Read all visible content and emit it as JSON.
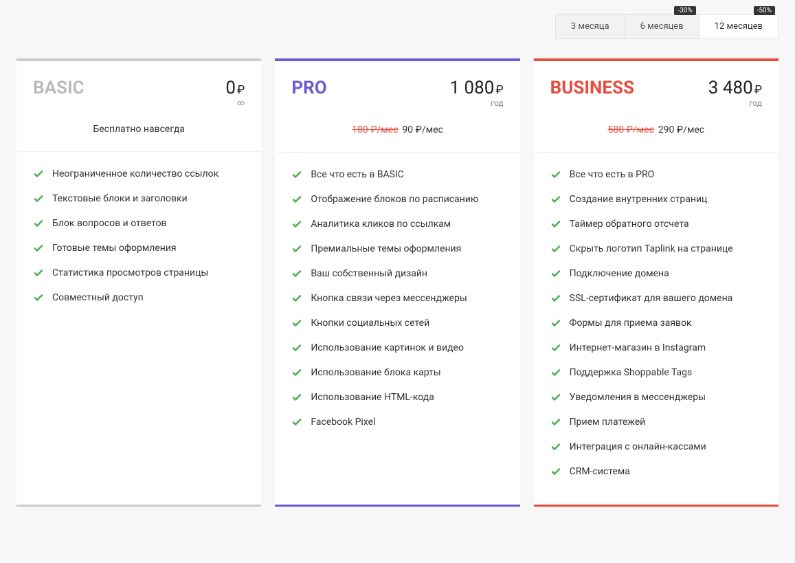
{
  "periodTabs": [
    {
      "label": "3 месяца",
      "badge": "",
      "active": false
    },
    {
      "label": "6 месяцев",
      "badge": "-30%",
      "active": false
    },
    {
      "label": "12 месяцев",
      "badge": "-50%",
      "active": true
    }
  ],
  "plans": [
    {
      "id": "basic",
      "name": "BASIC",
      "price": "0",
      "currency": "₽",
      "period": "∞",
      "subhead": {
        "strike": "",
        "text": "Бесплатно навсегда"
      },
      "features": [
        "Неограниченное количество ссылок",
        "Текстовые блоки и заголовки",
        "Блок вопросов и ответов",
        "Готовые темы оформления",
        "Статистика просмотров страницы",
        "Совместный доступ"
      ]
    },
    {
      "id": "pro",
      "name": "PRO",
      "price": "1 080",
      "currency": "₽",
      "period": "год",
      "subhead": {
        "strike": "180 ₽/мес",
        "text": "90 ₽/мес"
      },
      "features": [
        "Все что есть в BASIC",
        "Отображение блоков по расписанию",
        "Аналитика кликов по ссылкам",
        "Премиальные темы оформления",
        "Ваш собственный дизайн",
        "Кнопка связи через мессенджеры",
        "Кнопки социальных сетей",
        "Использование картинок и видео",
        "Использование блока карты",
        "Использование HTML-кода",
        "Facebook Pixel"
      ]
    },
    {
      "id": "business",
      "name": "BUSINESS",
      "price": "3 480",
      "currency": "₽",
      "period": "год",
      "subhead": {
        "strike": "580 ₽/мес",
        "text": "290 ₽/мес"
      },
      "features": [
        "Все что есть в PRO",
        "Создание внутренних страниц",
        "Таймер обратного отсчета",
        "Скрыть логотип Taplink на странице",
        "Подключение домена",
        "SSL-сертификат для вашего домена",
        "Формы для приема заявок",
        "Интернет-магазин в Instagram",
        "Поддержка Shoppable Tags",
        "Уведомления в мессенджеры",
        "Прием платежей",
        "Интеграция с онлайн-кассами",
        "CRM-система"
      ]
    }
  ]
}
